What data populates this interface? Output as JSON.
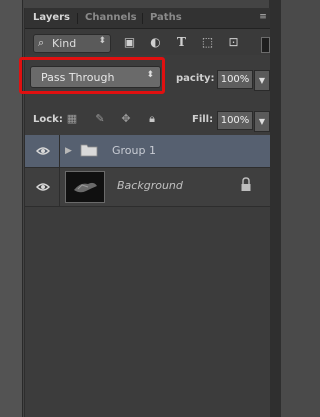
{
  "tabs": [
    {
      "label": "Layers",
      "active": true
    },
    {
      "label": "Channels",
      "active": false
    },
    {
      "label": "Paths",
      "active": false
    }
  ],
  "filter": {
    "kind_label": "Kind",
    "icons": [
      "pixel-filter-icon",
      "adjustment-filter-icon",
      "type-filter-icon",
      "shape-filter-icon",
      "smart-object-filter-icon"
    ]
  },
  "blend": {
    "mode": "Pass Through",
    "opacity_label": "pacity:",
    "opacity_value": "100%"
  },
  "lock": {
    "label": "Lock:",
    "fill_label": "Fill:",
    "fill_value": "100%"
  },
  "layers": [
    {
      "name": "Group 1",
      "type": "group",
      "visible": true,
      "selected": true
    },
    {
      "name": "Background",
      "type": "image",
      "visible": true,
      "locked": true
    }
  ],
  "colors": {
    "highlight": "#e01010",
    "selected_row": "#566070"
  }
}
